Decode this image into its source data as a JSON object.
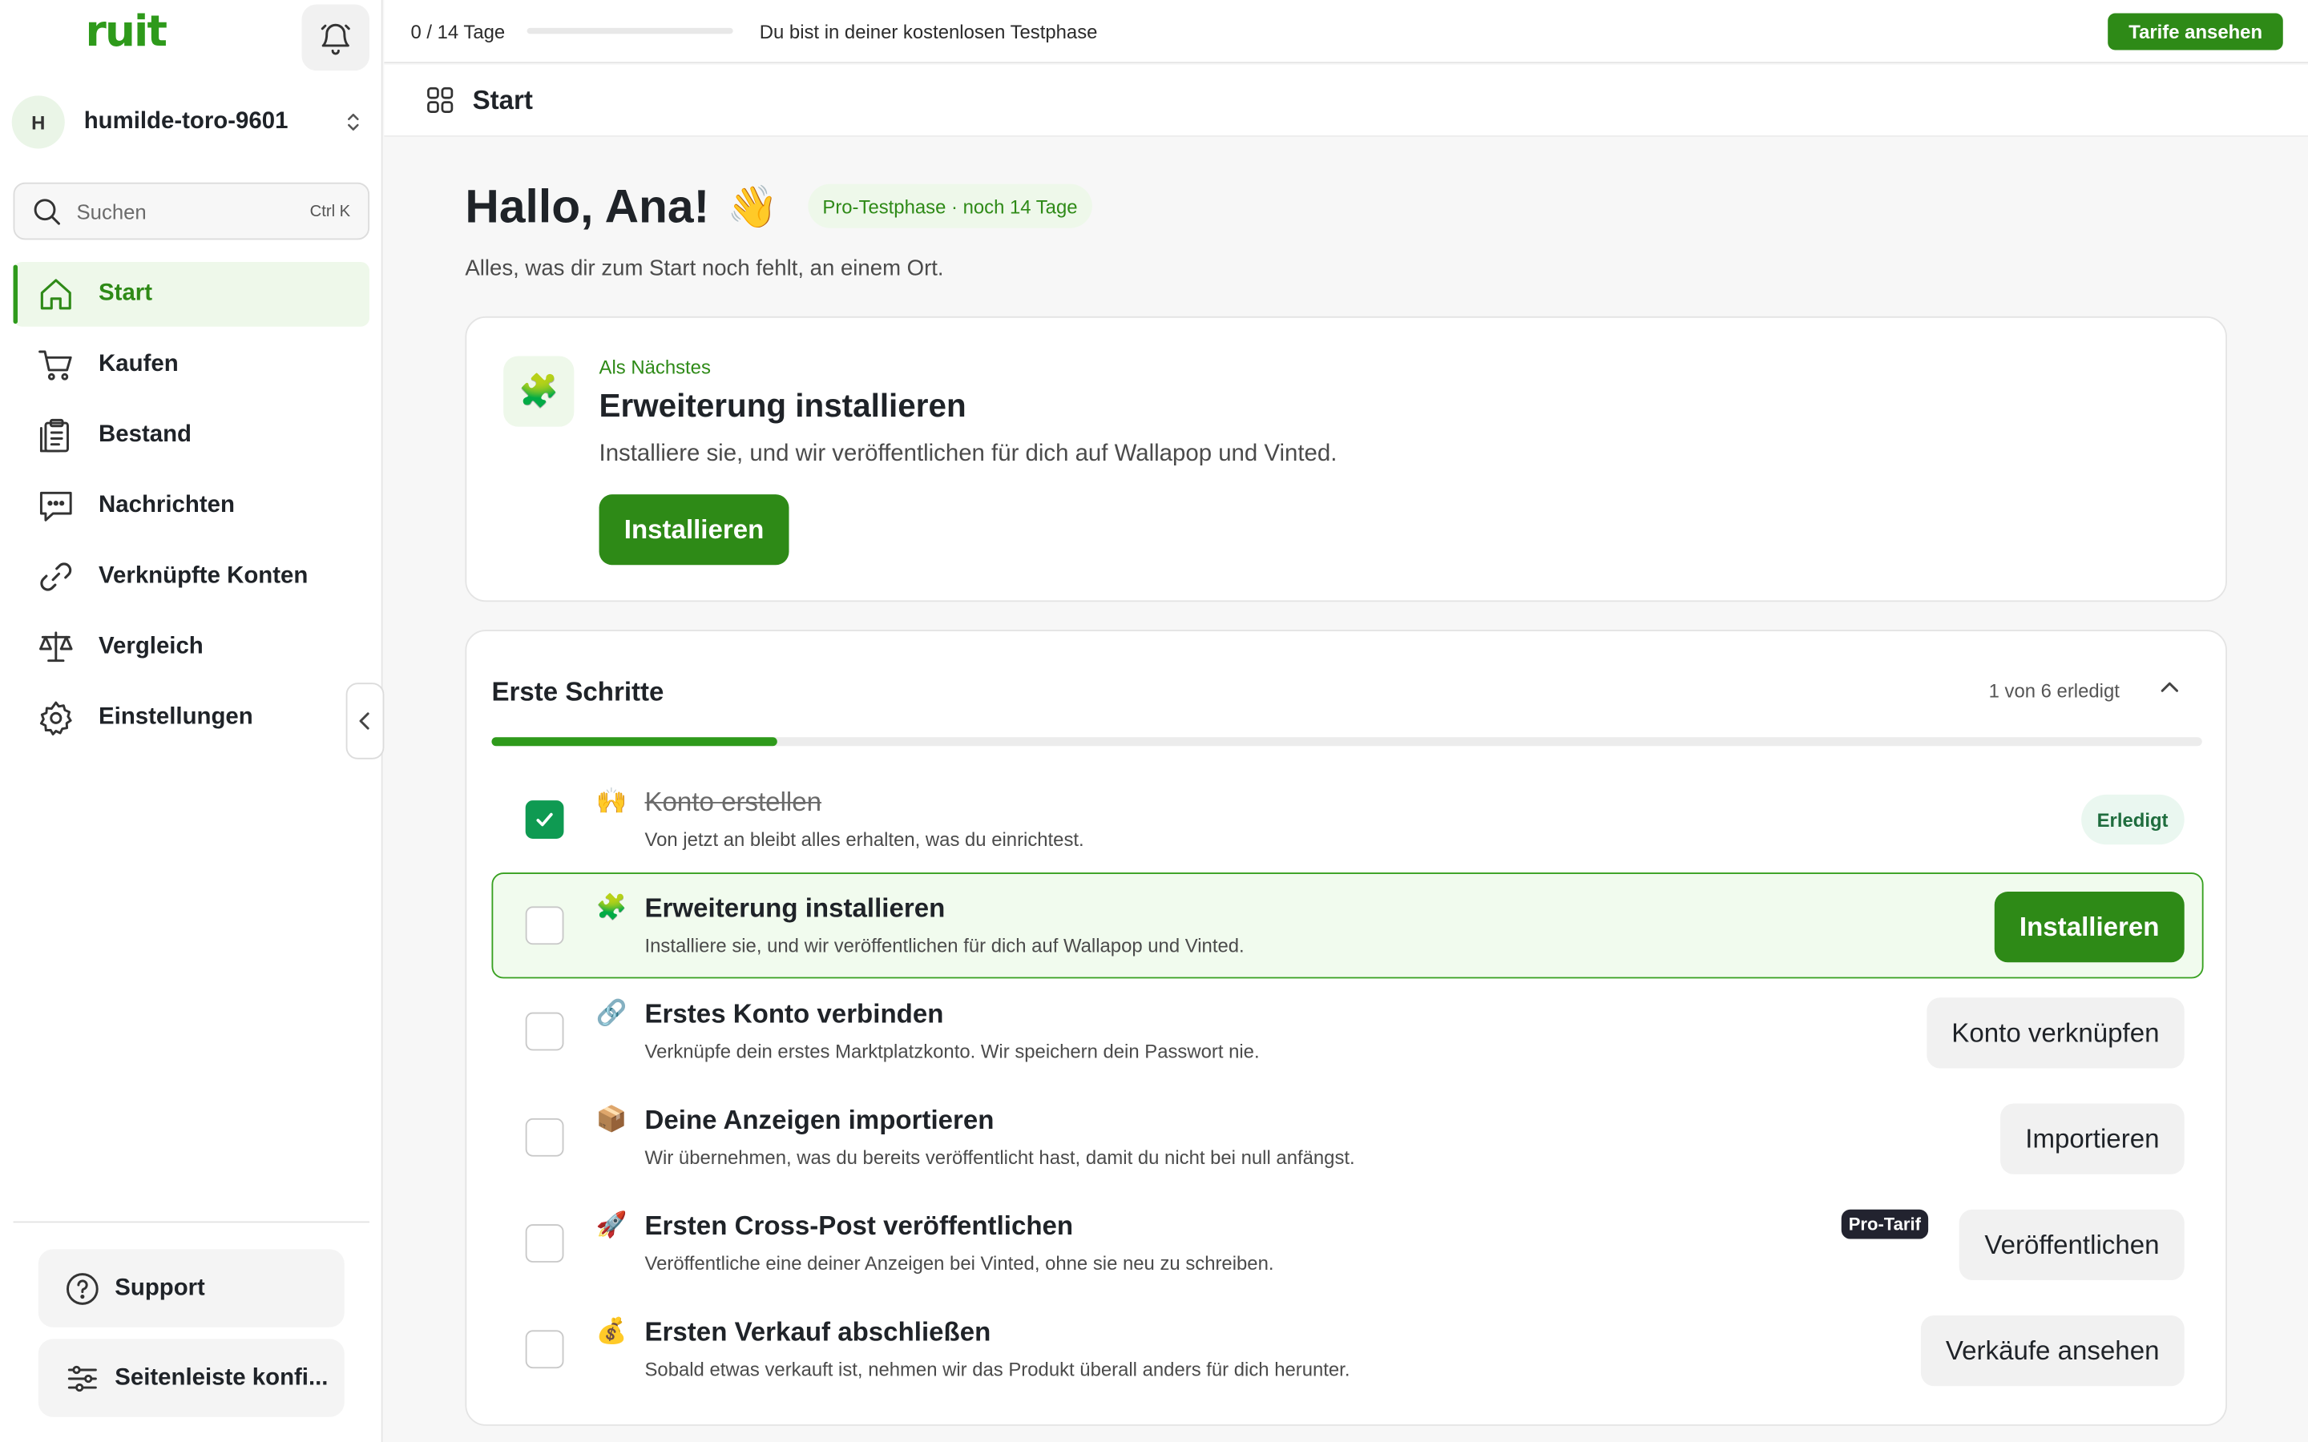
{
  "sidebar": {
    "logo": "ruit",
    "workspace": {
      "initial": "H",
      "name": "humilde-toro-9601"
    },
    "search": {
      "placeholder": "Suchen",
      "shortcut": "Ctrl K"
    },
    "nav": [
      {
        "label": "Start",
        "icon": "home-icon",
        "active": true
      },
      {
        "label": "Kaufen",
        "icon": "cart-icon",
        "active": false
      },
      {
        "label": "Bestand",
        "icon": "clipboard-icon",
        "active": false
      },
      {
        "label": "Nachrichten",
        "icon": "message-icon",
        "active": false
      },
      {
        "label": "Verknüpfte Konten",
        "icon": "link-icon",
        "active": false
      },
      {
        "label": "Vergleich",
        "icon": "scale-icon",
        "active": false
      },
      {
        "label": "Einstellungen",
        "icon": "gear-icon",
        "active": false
      }
    ],
    "support_label": "Support",
    "configure_label": "Seitenleiste konfi..."
  },
  "topbar": {
    "trial_days": "0 / 14 Tage",
    "trial_progress": 0,
    "trial_message": "Du bist in deiner kostenlosen Testphase",
    "plans_button": "Tarife ansehen"
  },
  "page": {
    "title": "Start"
  },
  "greeting": {
    "text": "Hallo, Ana!",
    "emoji": "👋",
    "badge": "Pro-Testphase · noch 14 Tage",
    "subtitle": "Alles, was dir zum Start noch fehlt, an einem Ort."
  },
  "next": {
    "emoji": "🧩",
    "eyebrow": "Als Nächstes",
    "title": "Erweiterung installieren",
    "description": "Installiere sie, und wir veröffentlichen für dich auf Wallapop und Vinted.",
    "button": "Installieren"
  },
  "steps": {
    "title": "Erste Schritte",
    "count": "1 von 6 erledigt",
    "progress": 0.1667,
    "items": [
      {
        "emoji": "🙌",
        "title": "Konto erstellen",
        "description": "Von jetzt an bleibt alles erhalten, was du einrichtest.",
        "done": true,
        "badge": "Erledigt"
      },
      {
        "emoji": "🧩",
        "title": "Erweiterung installieren",
        "description": "Installiere sie, und wir veröffentlichen für dich auf Wallapop und Vinted.",
        "done": false,
        "button": "Installieren"
      },
      {
        "emoji": "🔗",
        "title": "Erstes Konto verbinden",
        "description": "Verknüpfe dein erstes Marktplatzkonto. Wir speichern dein Passwort nie.",
        "done": false,
        "button": "Konto verknüpfen"
      },
      {
        "emoji": "📦",
        "title": "Deine Anzeigen importieren",
        "description": "Wir übernehmen, was du bereits veröffentlicht hast, damit du nicht bei null anfängst.",
        "done": false,
        "button": "Importieren"
      },
      {
        "emoji": "🚀",
        "title": "Ersten Cross-Post veröffentlichen",
        "description": "Veröffentliche eine deiner Anzeigen bei Vinted, ohne sie neu zu schreiben.",
        "done": false,
        "button": "Veröffentlichen",
        "tag": "Pro-Tarif"
      },
      {
        "emoji": "💰",
        "title": "Ersten Verkauf abschließen",
        "description": "Sobald etwas verkauft ist, nehmen wir das Produkt überall anders für dich herunter.",
        "done": false,
        "button": "Verkäufe ansehen"
      }
    ]
  },
  "colors": {
    "brand": "#2e9a1b",
    "brand_dark": "#2e8a17",
    "done_check": "#0f9a52",
    "highlight_bg": "#f1fbee"
  }
}
